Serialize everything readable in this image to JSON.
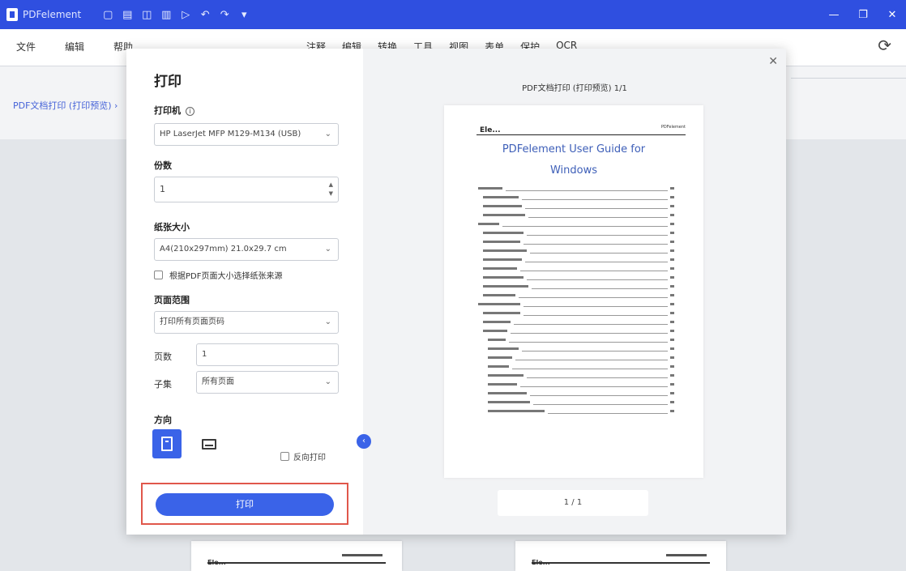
{
  "titlebar": {
    "app_title": "PDFelement",
    "qa_icons": [
      "save-icon",
      "print-icon",
      "undo-icon",
      "redo-icon",
      "share-icon",
      "arrow-icon",
      "ocr-icon",
      "pin-icon"
    ],
    "qa_glyphs": [
      "▢",
      "▤",
      "◫",
      "▥",
      "▷",
      "↶",
      "↷",
      "▾"
    ],
    "controls": [
      "—",
      "❐",
      "✕"
    ]
  },
  "menubar": {
    "left": [
      "文件",
      "编辑",
      "帮助"
    ],
    "center": [
      "注释",
      "编辑",
      "转换",
      "工具",
      "视图",
      "表单",
      "保护",
      "OCR"
    ]
  },
  "doc_breadcrumb": "PDF文档打印 (打印预览) ›",
  "dialog": {
    "title": "打印",
    "printer_label": "打印机",
    "printer_value": "HP LaserJet MFP M129-M134 (USB)",
    "copies_label": "份数",
    "copies_value": "1",
    "paper_label": "纸张大小",
    "paper_value": "A4(210x297mm) 21.0x29.7 cm",
    "auto_paper_label": "根据PDF页面大小选择纸张来源",
    "page_range_label": "页面范围",
    "page_range_value": "打印所有页面页码",
    "pages_label": "页数",
    "pages_value": "1",
    "subset_label": "子集",
    "subset_value": "所有页面",
    "orientation_label": "方向",
    "reverse_label": "反向打印",
    "print_button": "打印",
    "collapse_glyph": "‹",
    "close_glyph": "✕"
  },
  "preview": {
    "header": "PDF文档打印 (打印预览) 1/1",
    "page_logo": "Ele...",
    "page_right": "PDFelement",
    "page_title": "PDFelement User Guide for Windows",
    "page_indicator": "1 / 1"
  },
  "bg_thumb_logo": "Ele..."
}
